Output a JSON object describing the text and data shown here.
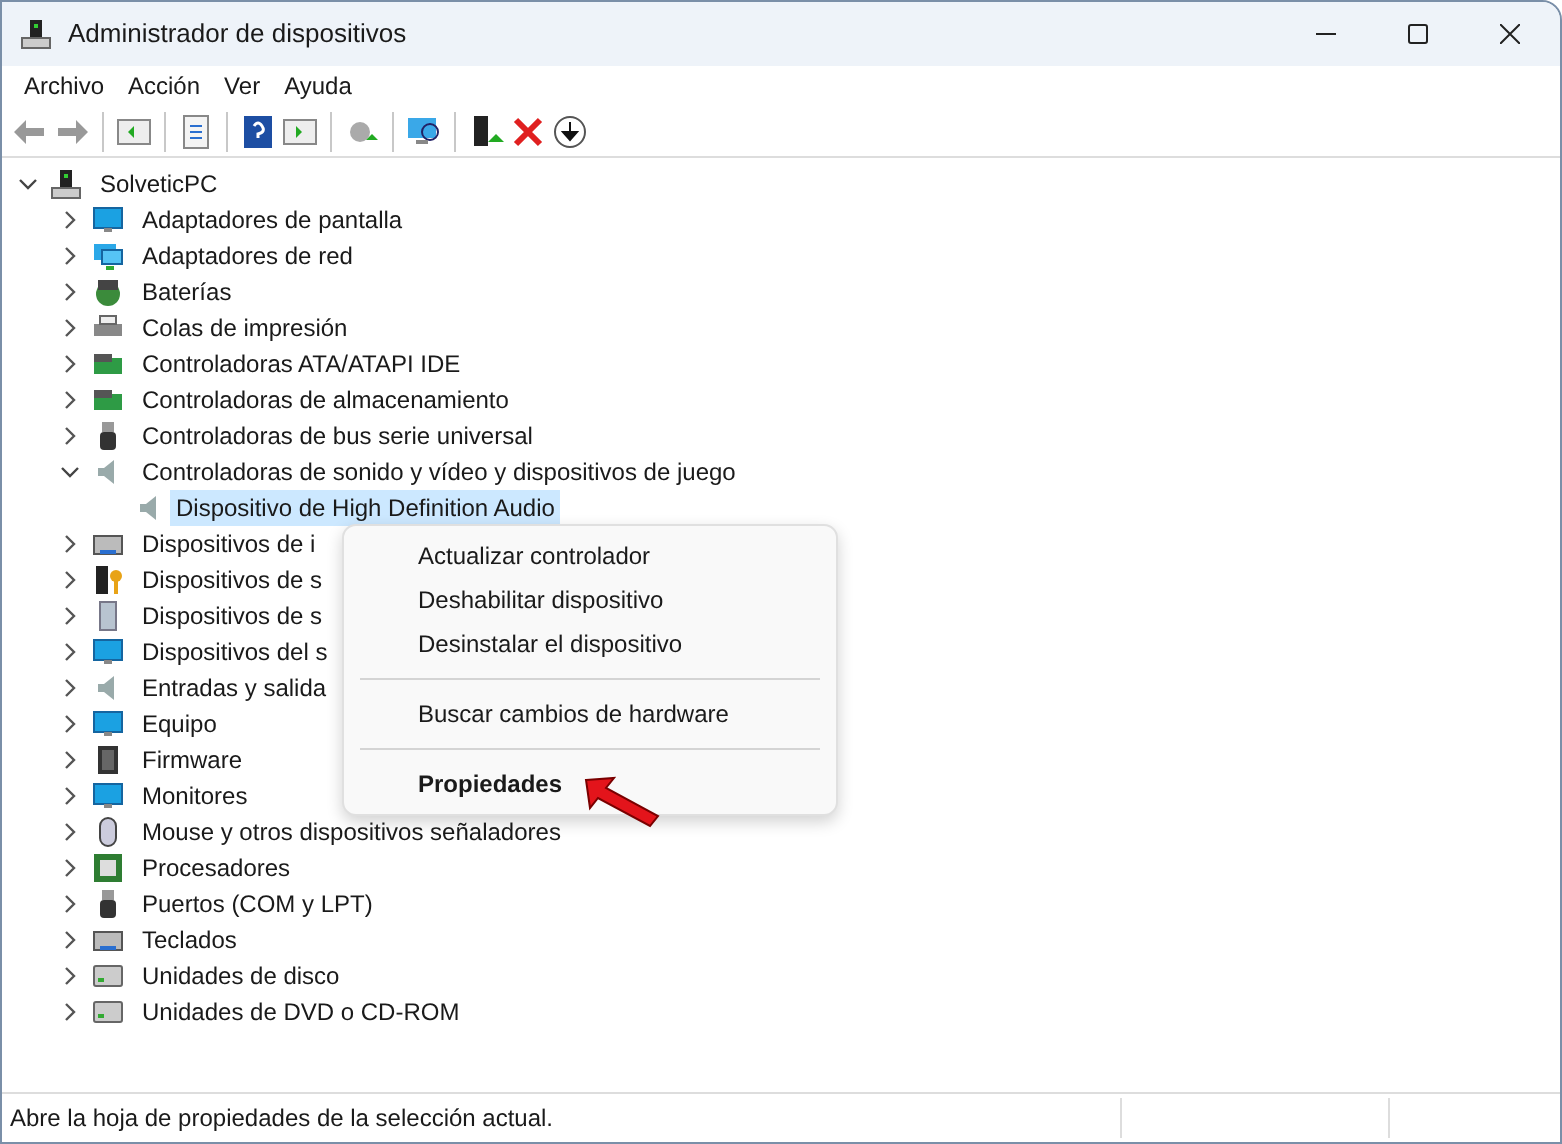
{
  "window": {
    "title": "Administrador de dispositivos"
  },
  "menu_bar": [
    "Archivo",
    "Acción",
    "Ver",
    "Ayuda"
  ],
  "tree": {
    "label": "SolveticPC",
    "expanded": true,
    "selected": false,
    "children": [
      {
        "label": "Adaptadores de pantalla",
        "expanded": false,
        "selected": false
      },
      {
        "label": "Adaptadores de red",
        "expanded": false,
        "selected": false
      },
      {
        "label": "Baterías",
        "expanded": false,
        "selected": false
      },
      {
        "label": "Colas de impresión",
        "expanded": false,
        "selected": false
      },
      {
        "label": "Controladoras ATA/ATAPI IDE",
        "expanded": false,
        "selected": false
      },
      {
        "label": "Controladoras de almacenamiento",
        "expanded": false,
        "selected": false
      },
      {
        "label": "Controladoras de bus serie universal",
        "expanded": false,
        "selected": false
      },
      {
        "label": "Controladoras de sonido y vídeo y dispositivos de juego",
        "expanded": true,
        "selected": false,
        "children": [
          {
            "label": "Dispositivo de High Definition Audio",
            "selected": true
          }
        ]
      },
      {
        "label": "Dispositivos de i",
        "expanded": false,
        "selected": false
      },
      {
        "label": "Dispositivos de s",
        "expanded": false,
        "selected": false
      },
      {
        "label": "Dispositivos de s",
        "expanded": false,
        "selected": false
      },
      {
        "label": "Dispositivos del s",
        "expanded": false,
        "selected": false
      },
      {
        "label": "Entradas y salida",
        "expanded": false,
        "selected": false
      },
      {
        "label": "Equipo",
        "expanded": false,
        "selected": false
      },
      {
        "label": "Firmware",
        "expanded": false,
        "selected": false
      },
      {
        "label": "Monitores",
        "expanded": false,
        "selected": false
      },
      {
        "label": "Mouse y otros dispositivos señaladores",
        "expanded": false,
        "selected": false
      },
      {
        "label": "Procesadores",
        "expanded": false,
        "selected": false
      },
      {
        "label": "Puertos (COM y LPT)",
        "expanded": false,
        "selected": false
      },
      {
        "label": "Teclados",
        "expanded": false,
        "selected": false
      },
      {
        "label": "Unidades de disco",
        "expanded": false,
        "selected": false
      },
      {
        "label": "Unidades de DVD o CD-ROM",
        "expanded": false,
        "selected": false
      }
    ]
  },
  "context_menu": [
    {
      "kind": "item",
      "label": "Actualizar controlador",
      "bold": false
    },
    {
      "kind": "item",
      "label": "Deshabilitar dispositivo",
      "bold": false
    },
    {
      "kind": "item",
      "label": "Desinstalar el dispositivo",
      "bold": false
    },
    {
      "kind": "separator"
    },
    {
      "kind": "item",
      "label": "Buscar cambios de hardware",
      "bold": false
    },
    {
      "kind": "separator"
    },
    {
      "kind": "item",
      "label": "Propiedades",
      "bold": true
    }
  ],
  "status_bar": {
    "text": "Abre la hoja de propiedades de la selección actual."
  }
}
